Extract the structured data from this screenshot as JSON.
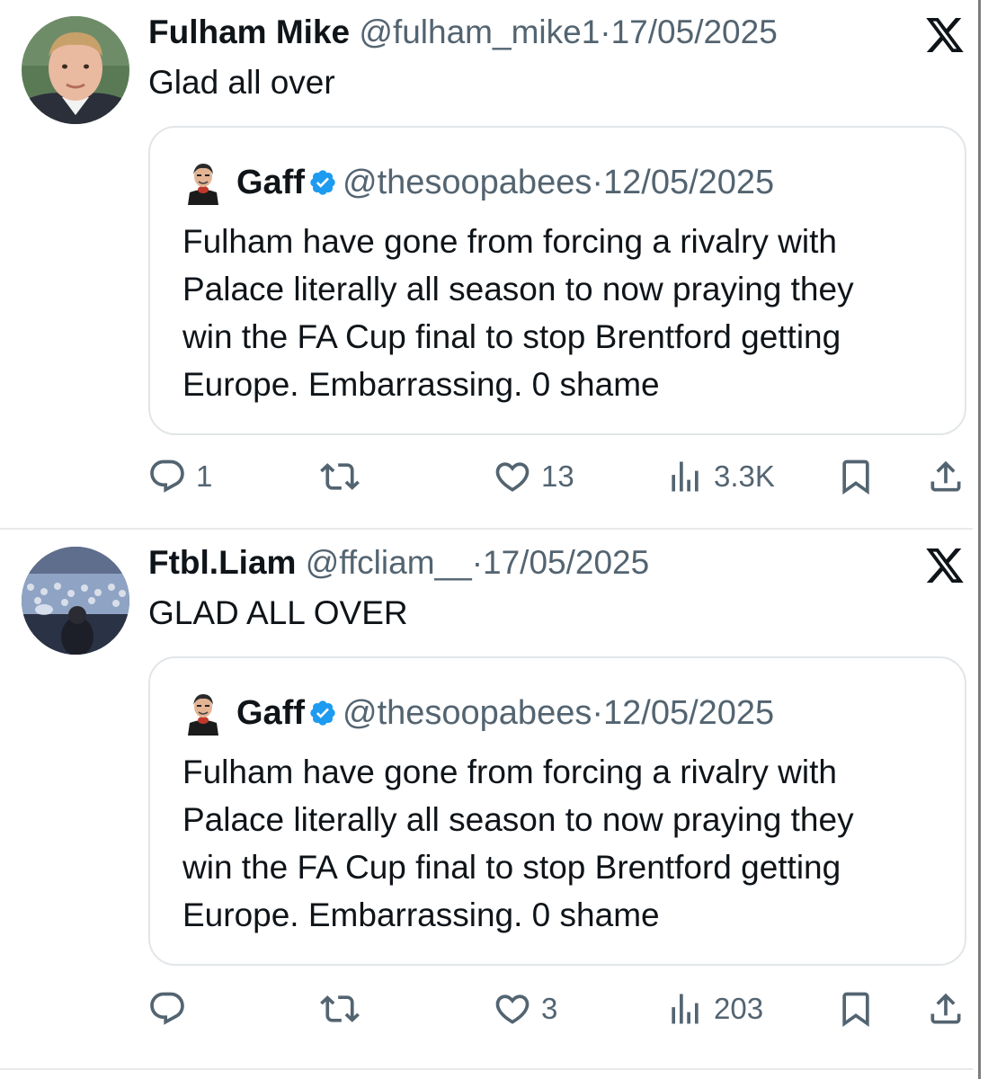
{
  "tweets": [
    {
      "author_name": "Fulham Mike",
      "handle": "@fulham_mike1",
      "separator": "·",
      "date": "17/05/2025",
      "text": "Glad all over",
      "quote": {
        "author_name": "Gaff",
        "handle": "@thesoopabees",
        "separator": "·",
        "date": "12/05/2025",
        "text_lines": [
          "Fulham have gone from forcing a rivalry with",
          "Palace literally all season to now praying they",
          "win the FA Cup final to stop Brentford getting",
          "Europe. Embarrassing. 0 shame"
        ]
      },
      "actions": {
        "replies": "1",
        "retweets": "",
        "likes": "13",
        "views": "3.3K"
      }
    },
    {
      "author_name": "Ftbl.Liam",
      "handle": "@ffcliam__",
      "separator": "·",
      "date": "17/05/2025",
      "text": "GLAD ALL OVER",
      "quote": {
        "author_name": "Gaff",
        "handle": "@thesoopabees",
        "separator": "·",
        "date": "12/05/2025",
        "text_lines": [
          "Fulham have gone from forcing a rivalry with",
          "Palace literally all season to now praying they",
          "win the FA Cup final to stop Brentford getting",
          "Europe. Embarrassing. 0 shame"
        ]
      },
      "actions": {
        "replies": "",
        "retweets": "",
        "likes": "3",
        "views": "203"
      }
    }
  ],
  "icons": {
    "platform": "x-logo-icon",
    "verified": "verified-badge-icon",
    "reply": "reply-icon",
    "retweet": "retweet-icon",
    "like": "heart-icon",
    "views": "views-chart-icon",
    "bookmark": "bookmark-icon",
    "share": "share-icon"
  },
  "colors": {
    "text_primary": "#0f1419",
    "text_secondary": "#536471",
    "verified_blue": "#1d9bf0",
    "border": "#e2e6e9"
  }
}
